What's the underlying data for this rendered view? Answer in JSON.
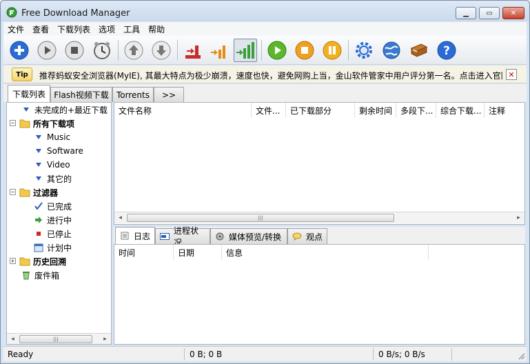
{
  "window": {
    "title": "Free Download Manager"
  },
  "menu": [
    "文件",
    "查看",
    "下载列表",
    "选项",
    "工具",
    "帮助"
  ],
  "toolbar": {
    "buttons": [
      "add-icon",
      "play-icon",
      "stop-icon",
      "scheduler-clock-icon",
      "move-up-icon",
      "move-down-icon",
      "traffic-low-icon",
      "traffic-medium-icon",
      "traffic-high-icon",
      "start-all-icon",
      "stop-all-icon",
      "pause-all-icon",
      "settings-gear-icon",
      "community-globe-icon",
      "tutorial-book-icon",
      "help-icon"
    ],
    "active": "traffic-high-icon"
  },
  "tip": {
    "badge": "Tip",
    "text": "推荐蚂蚁安全浏览器(MyIE), 其最大特点为极少崩溃，速度也快，避免网购上当，金山软件管家中用户评分第一名。点击进入官网"
  },
  "tabs": [
    "下载列表",
    "Flash视频下载",
    "Torrents",
    ">>"
  ],
  "tree": {
    "recent": "未完成的+最近下载",
    "all": "所有下载项",
    "categories": [
      "Music",
      "Software",
      "Video",
      "其它的"
    ],
    "filters": "过滤器",
    "filter_items": [
      "已完成",
      "进行中",
      "已停止",
      "计划中"
    ],
    "history": "历史回溯",
    "trash": "废件箱"
  },
  "download_columns": [
    "文件名称",
    "文件...",
    "已下载部分",
    "剩余时间",
    "多段下...",
    "综合下载...",
    "注释"
  ],
  "bottom_tabs": [
    "日志",
    "进程状况",
    "媒体预览/转换",
    "观点"
  ],
  "log_columns": [
    "时间",
    "日期",
    "信息"
  ],
  "status": {
    "state": "Ready",
    "size": "0 B; 0 B",
    "speed": "0 B/s; 0 B/s"
  },
  "colors": {
    "accent": "#2a6bd6",
    "window_frame": "#d7e4f2"
  }
}
